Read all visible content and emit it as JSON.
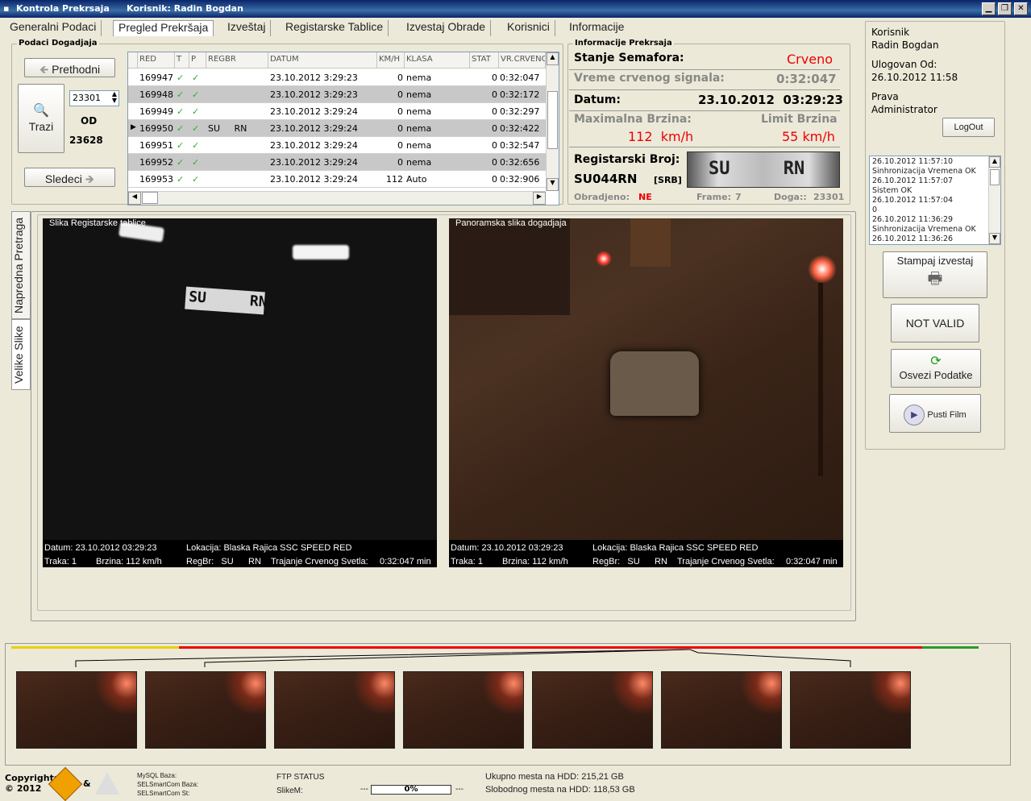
{
  "window": {
    "title": "Kontrola Prekrsaja",
    "user": "Korisnik: Radin Bogdan",
    "btn_min": "▁",
    "btn_max": "❐",
    "btn_close": "✕"
  },
  "tabs": [
    "Generalni Podaci",
    "Pregled Prekršaja",
    "Izveštaj",
    "Registarske Tablice",
    "Izvestaj Obrade",
    "Korisnici",
    "Informacije"
  ],
  "event": {
    "group_label": "Podaci Dogadjaja",
    "prev_label": "Prethodni",
    "search_label": "Trazi",
    "next_label": "Sledeci",
    "current": "23301",
    "of_label": "OD",
    "total": "23628"
  },
  "grid": {
    "headers": [
      "RED",
      "T",
      "P",
      "REGBR",
      "DATUM",
      "KM/H",
      "KLASA",
      "STAT",
      "VR.CRVENO"
    ],
    "rows": [
      {
        "red": "169947",
        "t": "✓",
        "p": "✓",
        "regbr": "",
        "datum": "23.10.2012 3:29:23",
        "kmh": "0",
        "klasa": "nema",
        "stat": "0",
        "vr": "0:32:047"
      },
      {
        "red": "169948",
        "t": "✓",
        "p": "✓",
        "regbr": "",
        "datum": "23.10.2012 3:29:23",
        "kmh": "0",
        "klasa": "nema",
        "stat": "0",
        "vr": "0:32:172"
      },
      {
        "red": "169949",
        "t": "✓",
        "p": "✓",
        "regbr": "",
        "datum": "23.10.2012 3:29:24",
        "kmh": "0",
        "klasa": "nema",
        "stat": "0",
        "vr": "0:32:297"
      },
      {
        "red": "169950",
        "t": "✓",
        "p": "✓",
        "regbr": "SU     RN",
        "datum": "23.10.2012 3:29:24",
        "kmh": "0",
        "klasa": "nema",
        "stat": "0",
        "vr": "0:32:422"
      },
      {
        "red": "169951",
        "t": "✓",
        "p": "✓",
        "regbr": "",
        "datum": "23.10.2012 3:29:24",
        "kmh": "0",
        "klasa": "nema",
        "stat": "0",
        "vr": "0:32:547"
      },
      {
        "red": "169952",
        "t": "✓",
        "p": "✓",
        "regbr": "",
        "datum": "23.10.2012 3:29:24",
        "kmh": "0",
        "klasa": "nema",
        "stat": "0",
        "vr": "0:32:656"
      },
      {
        "red": "169953",
        "t": "✓",
        "p": "✓",
        "regbr": "",
        "datum": "23.10.2012 3:29:24",
        "kmh": "112",
        "klasa": "Auto",
        "stat": "0",
        "vr": "0:32:906"
      }
    ]
  },
  "info": {
    "group_label": "Informacije Prekrsaja",
    "semafor_label": "Stanje Semafora:",
    "semafor_value": "Crveno",
    "red_time_label": "Vreme crvenog signala:",
    "red_time_value": "0:32:047",
    "date_label": "Datum:",
    "date_value": "23.10.2012  03:29:23",
    "max_speed_label": "Maximalna Brzina:",
    "max_speed_value": "112  km/h",
    "limit_label": "Limit Brzina",
    "limit_value": "55 km/h",
    "reg_label": "Registarski Broj:",
    "reg_value": "SU044RN",
    "reg_country": "[SRB]",
    "plate_text": "SU     RN",
    "processed_label": "Obradjeno:",
    "processed_value": "NE",
    "frame_label": "Frame:",
    "frame_value": "7",
    "event_label": "Doga::",
    "event_value": "23301"
  },
  "user_panel": {
    "user_label": "Korisnik",
    "user_name": "Radin Bogdan",
    "logged_label": "Ulogovan Od:",
    "logged_value": "26.10.2012 11:58",
    "rights_label": "Prava",
    "rights_value": "Administrator",
    "logout": "LogOut"
  },
  "log": [
    "26.10.2012 11:57:10",
    "Sinhronizacija Vremena OK",
    "26.10.2012 11:57:07",
    "Sistem OK",
    "26.10.2012 11:57:04",
    "0",
    "26.10.2012 11:36:29",
    "Sinhronizacija Vremena OK",
    "26.10.2012 11:36:26"
  ],
  "actions": {
    "print": "Stampaj izvestaj",
    "not_valid": "NOT VALID",
    "refresh": "Osvezi Podatke",
    "play": "Pusti Film"
  },
  "side_tabs": [
    "Napredna Pretraga",
    "Velike Slike"
  ],
  "images": [
    {
      "title": "Slika Registarske tablice",
      "datum": "Datum:  23.10.2012  03:29:23",
      "lokacija": "Lokacija:  Blaska Rajica SSC SPEED RED",
      "traka": "Traka:  1",
      "brzina": "Brzina:   112 km/h",
      "regbr": "RegBr:   SU      RN",
      "trajanje": "Trajanje Crvenog Svetla:",
      "trajanje_val": "0:32:047 min"
    },
    {
      "title": "Panoramska slika dogadjaja",
      "datum": "Datum:  23.10.2012  03:29:23",
      "lokacija": "Lokacija:  Blaska Rajica SSC SPEED RED",
      "traka": "Traka:  1",
      "brzina": "Brzina:   112 km/h",
      "regbr": "RegBr:   SU      RN",
      "trajanje": "Trajanje Crvenog Svetla:",
      "trajanje_val": "0:32:047 min"
    }
  ],
  "status": {
    "copyright": "Copyrights",
    "year": "© 2012",
    "amp": "&",
    "db1": "MySQL Baza:",
    "db2": "SELSmartCom Baza:",
    "db3": "SELSmartCom St:",
    "ftp": "FTP STATUS",
    "slike": "SlikeM:",
    "dash1": "---",
    "progress": "0%",
    "dash2": "---",
    "hdd_total": "Ukupno mesta na HDD: 215,21 GB",
    "hdd_free": "Slobodnog mesta na HDD: 118,53 GB"
  }
}
